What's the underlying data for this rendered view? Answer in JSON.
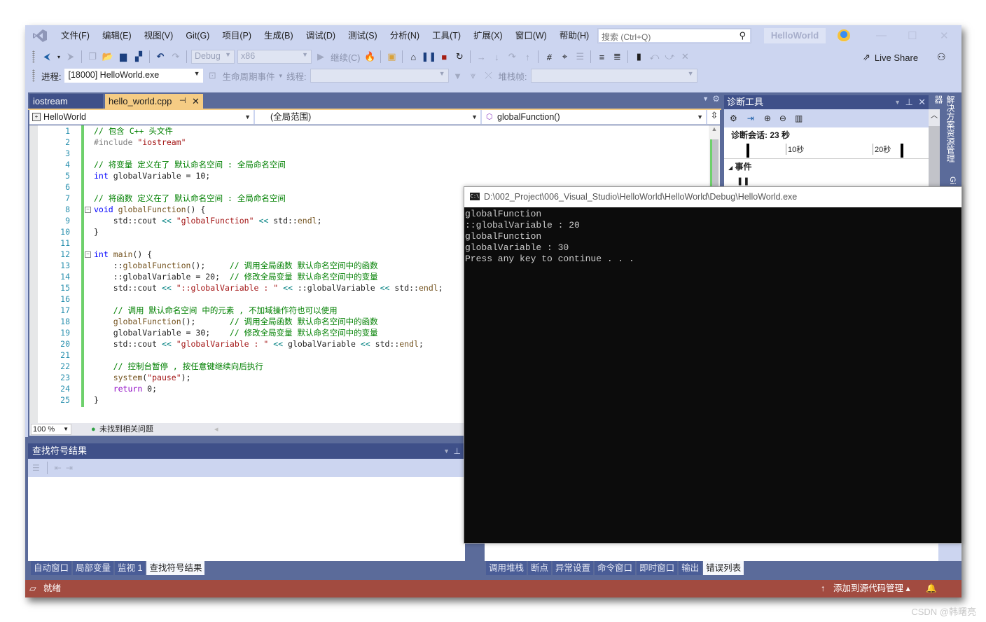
{
  "menu": [
    "文件(F)",
    "编辑(E)",
    "视图(V)",
    "Git(G)",
    "项目(P)",
    "生成(B)",
    "调试(D)",
    "测试(S)",
    "分析(N)",
    "工具(T)",
    "扩展(X)",
    "窗口(W)",
    "帮助(H)"
  ],
  "search": {
    "placeholder": "搜索 (Ctrl+Q)"
  },
  "solution_name": "HelloWorld",
  "toolbar": {
    "config": "Debug",
    "platform": "x86",
    "continue_label": "继续(C)",
    "live_share": "Live Share"
  },
  "debug_location": {
    "process_label": "进程:",
    "process_value": "[18000] HelloWorld.exe",
    "lifecycle_label": "生命周期事件",
    "thread_label": "线程:",
    "stackframe_label": "堆栈帧:"
  },
  "tabs": [
    {
      "label": "iostream",
      "active": false
    },
    {
      "label": "hello_world.cpp",
      "active": true
    }
  ],
  "navbar": {
    "project": "HelloWorld",
    "scope": "(全局范围)",
    "member": "globalFunction()"
  },
  "code": {
    "line_numbers": [
      "1",
      "2",
      "3",
      "4",
      "5",
      "6",
      "7",
      "8",
      "9",
      "10",
      "11",
      "12",
      "13",
      "14",
      "15",
      "16",
      "17",
      "18",
      "19",
      "20",
      "21",
      "22",
      "23",
      "24",
      "25"
    ],
    "lines": [
      "// 包含 C++ 头文件",
      "#include \"iostream\"",
      "",
      "// 将变量 定义在了 默认命名空间 : 全局命名空间",
      "int globalVariable = 10;",
      "",
      "// 将函数 定义在了 默认命名空间 : 全局命名空间",
      "void globalFunction() {",
      "    std::cout << \"globalFunction\" << std::endl;",
      "}",
      "",
      "int main() {",
      "    ::globalFunction();     // 调用全局函数 默认命名空间中的函数",
      "    ::globalVariable = 20;  // 修改全局变量 默认命名空间中的变量",
      "    std::cout << \"::globalVariable : \" << ::globalVariable << std::endl;",
      "",
      "    // 调用 默认命名空间 中的元素 , 不加域操作符也可以使用",
      "    globalFunction();       // 调用全局函数 默认命名空间中的函数",
      "    globalVariable = 30;    // 修改全局变量 默认命名空间中的变量",
      "    std::cout << \"globalVariable : \" << globalVariable << std::endl;",
      "",
      "    // 控制台暂停 , 按任意键继续向后执行",
      "    system(\"pause\");",
      "    return 0;",
      "}"
    ]
  },
  "editor_status": {
    "zoom": "100 %",
    "issues": "未找到相关问题"
  },
  "find_symbol_panel": {
    "title": "查找符号结果"
  },
  "bottom_tabs_left": [
    {
      "label": "自动窗口",
      "selected": false
    },
    {
      "label": "局部变量",
      "selected": false
    },
    {
      "label": "监视 1",
      "selected": false
    },
    {
      "label": "查找符号结果",
      "selected": true
    }
  ],
  "bottom_tabs_right": [
    {
      "label": "调用堆栈",
      "selected": false
    },
    {
      "label": "断点",
      "selected": false
    },
    {
      "label": "异常设置",
      "selected": false
    },
    {
      "label": "命令窗口",
      "selected": false
    },
    {
      "label": "即时窗口",
      "selected": false
    },
    {
      "label": "输出",
      "selected": false
    },
    {
      "label": "错误列表",
      "selected": true
    }
  ],
  "diagnostics": {
    "title": "诊断工具",
    "session": "诊断会话: 23 秒",
    "tick_10": "10秒",
    "tick_20": "20秒",
    "events_label": "事件"
  },
  "side_tabs": {
    "solution_explorer": "解决方案资源管理器",
    "git": "Gi"
  },
  "statusbar": {
    "ready": "就绪",
    "source_control": "添加到源代码管理"
  },
  "console": {
    "title": "D:\\002_Project\\006_Visual_Studio\\HelloWorld\\HelloWorld\\Debug\\HelloWorld.exe",
    "icon_text": "C:\\",
    "output": [
      "globalFunction",
      "::globalVariable : 20",
      "globalFunction",
      "globalVariable : 30",
      "Press any key to continue . . ."
    ]
  },
  "watermark": "CSDN @韩曙亮",
  "colors": {
    "accent": "#3f5089",
    "status_bar": "#a24b40",
    "active_tab": "#f5cc84",
    "change_bar": "#6ed06c"
  }
}
